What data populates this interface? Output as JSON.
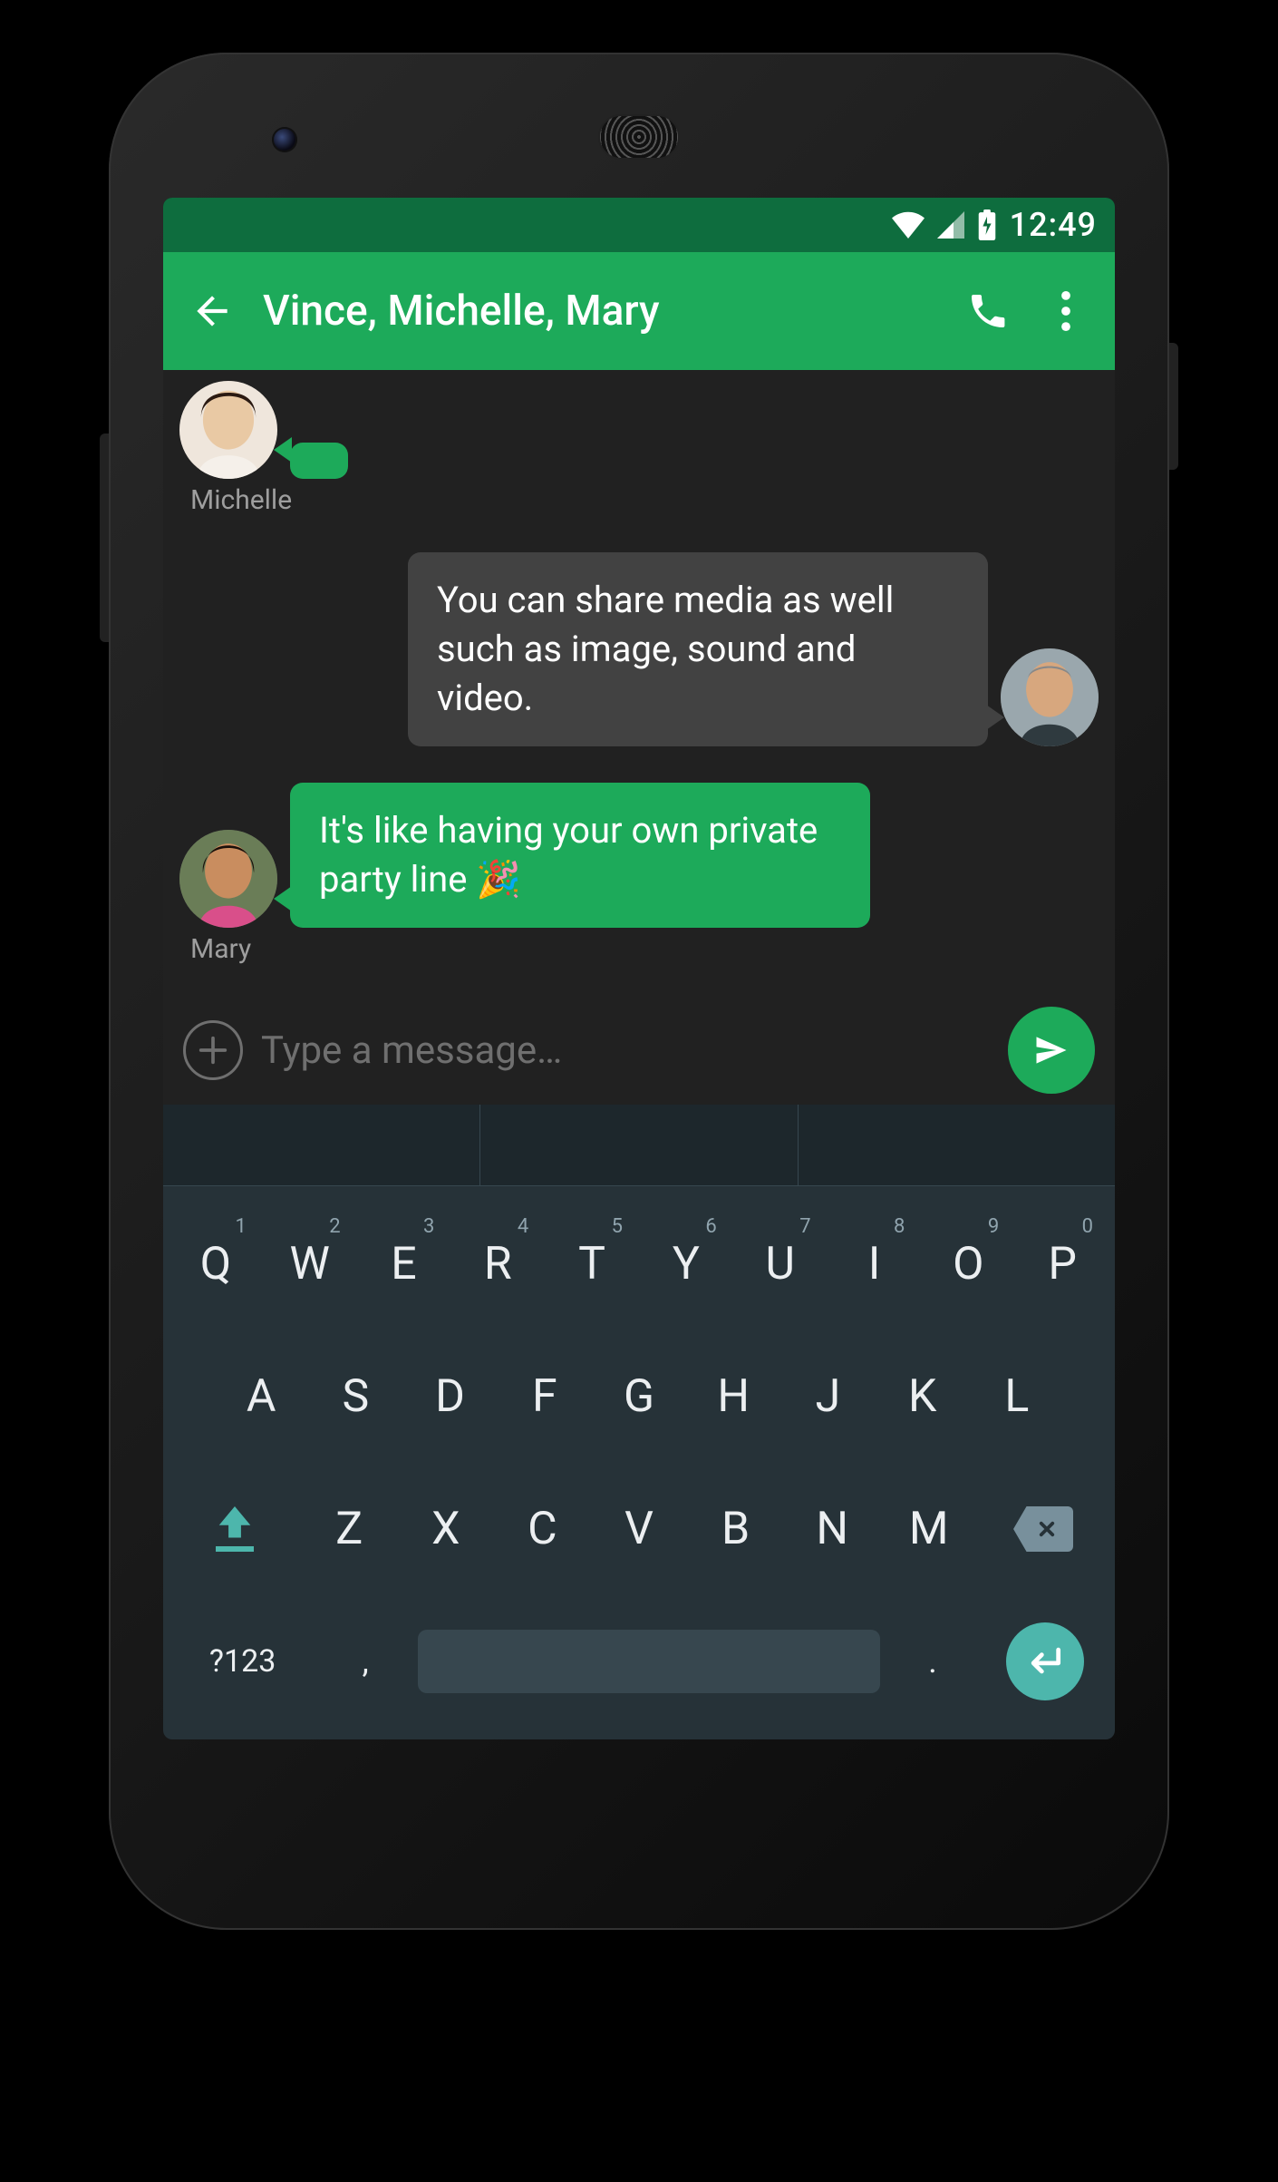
{
  "statusbar": {
    "time": "12:49"
  },
  "appbar": {
    "title": "Vince, Michelle, Mary"
  },
  "messages": {
    "michelle_name": "Michelle",
    "mary_name": "Mary",
    "vince_text": "You can share media as well such as image, sound and video.",
    "mary_text": "It's like having your own private party line 🎉"
  },
  "compose": {
    "placeholder": "Type a message…"
  },
  "keyboard": {
    "row1": [
      {
        "k": "Q",
        "n": "1"
      },
      {
        "k": "W",
        "n": "2"
      },
      {
        "k": "E",
        "n": "3"
      },
      {
        "k": "R",
        "n": "4"
      },
      {
        "k": "T",
        "n": "5"
      },
      {
        "k": "Y",
        "n": "6"
      },
      {
        "k": "U",
        "n": "7"
      },
      {
        "k": "I",
        "n": "8"
      },
      {
        "k": "O",
        "n": "9"
      },
      {
        "k": "P",
        "n": "0"
      }
    ],
    "row2": [
      "A",
      "S",
      "D",
      "F",
      "G",
      "H",
      "J",
      "K",
      "L"
    ],
    "row3": [
      "Z",
      "X",
      "C",
      "V",
      "B",
      "N",
      "M"
    ],
    "sym_label": "?123",
    "comma": ",",
    "period": "."
  }
}
